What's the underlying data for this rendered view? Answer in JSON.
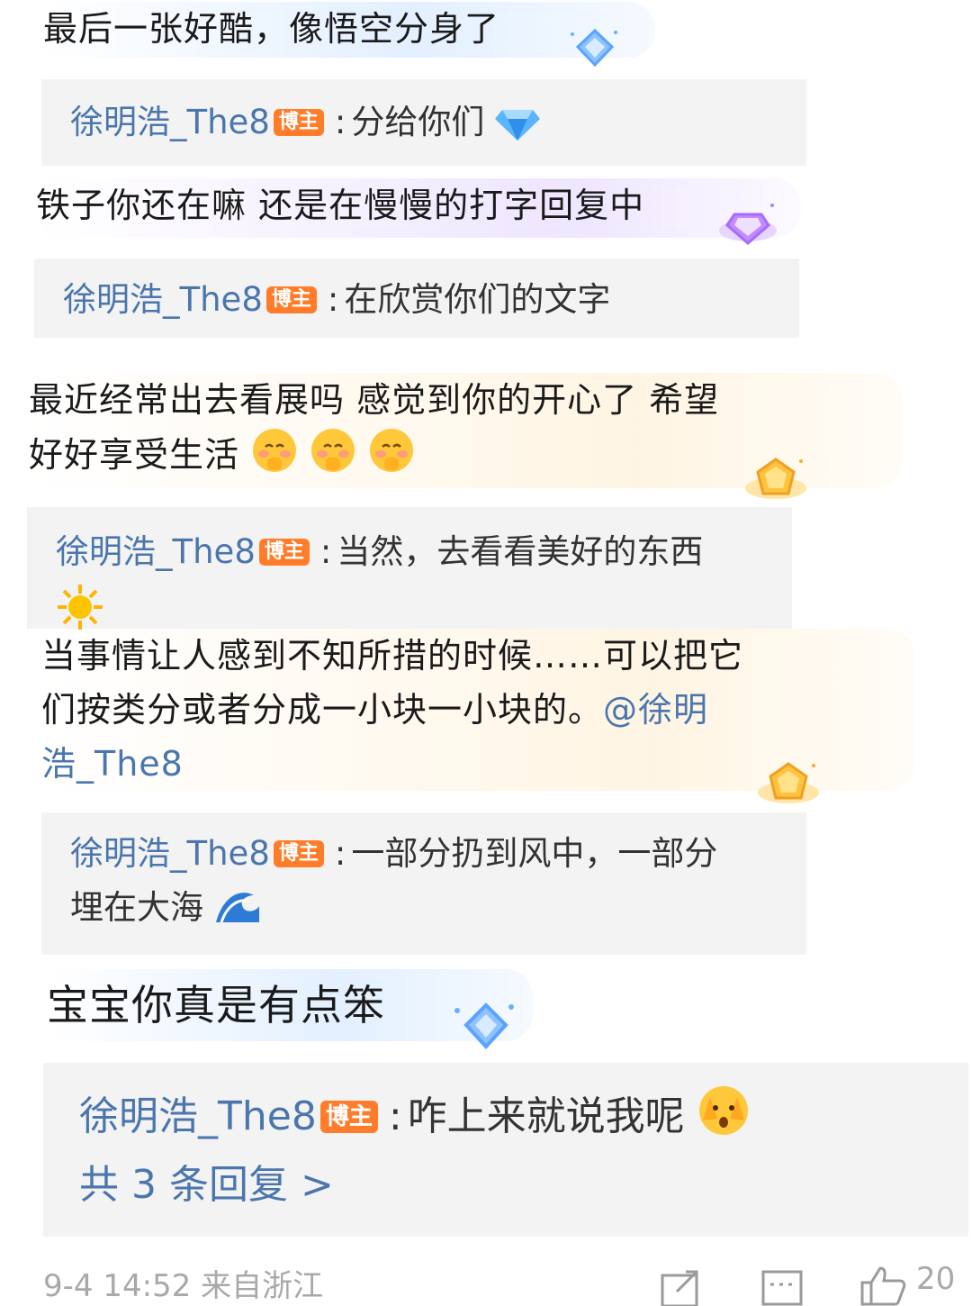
{
  "threads": [
    {
      "comment": "最后一张好酷，像悟空分身了",
      "reply_author": "徐明浩_The8",
      "reply_tag": "博主",
      "reply_text": "分给你们"
    },
    {
      "comment": "铁子你还在嘛 还是在慢慢的打字回复中",
      "reply_author": "徐明浩_The8",
      "reply_tag": "博主",
      "reply_text": "在欣赏你们的文字"
    },
    {
      "comment_line1": "最近经常出去看展吗 感觉到你的开心了 希望",
      "comment_line2": "好好享受生活",
      "reply_author": "徐明浩_The8",
      "reply_tag": "博主",
      "reply_text": "当然，去看看美好的东西"
    },
    {
      "comment_line1": "当事情让人感到不知所措的时候……可以把它",
      "comment_line2_text": "们按类分或者分成一小块一小块的。",
      "comment_line2_mention": "@徐明",
      "comment_line3_mention": "浩_The8",
      "reply_author": "徐明浩_The8",
      "reply_tag": "博主",
      "reply_text_line1": "一部分扔到风中，一部分",
      "reply_text_line2": "埋在大海"
    },
    {
      "comment": "宝宝你真是有点笨",
      "reply_author": "徐明浩_The8",
      "reply_tag": "博主",
      "reply_text": "咋上来就说我呢",
      "more_replies": "共 3 条回复 >"
    }
  ],
  "footer": {
    "time_location": "9-4 14:52 来自浙江",
    "like_count": "20"
  },
  "colors": {
    "author_blue": "#4a76ad",
    "tag_orange": "#ff7d2a",
    "reply_bg": "#f3f3f3"
  },
  "icons": [
    "diamond-badge-icon",
    "gem-emoji-icon",
    "purple-badge-icon",
    "gold-badge-icon",
    "shy-face-emoji",
    "sun-emoji",
    "wave-emoji",
    "peek-face-emoji",
    "share-icon",
    "comment-icon",
    "like-icon"
  ]
}
